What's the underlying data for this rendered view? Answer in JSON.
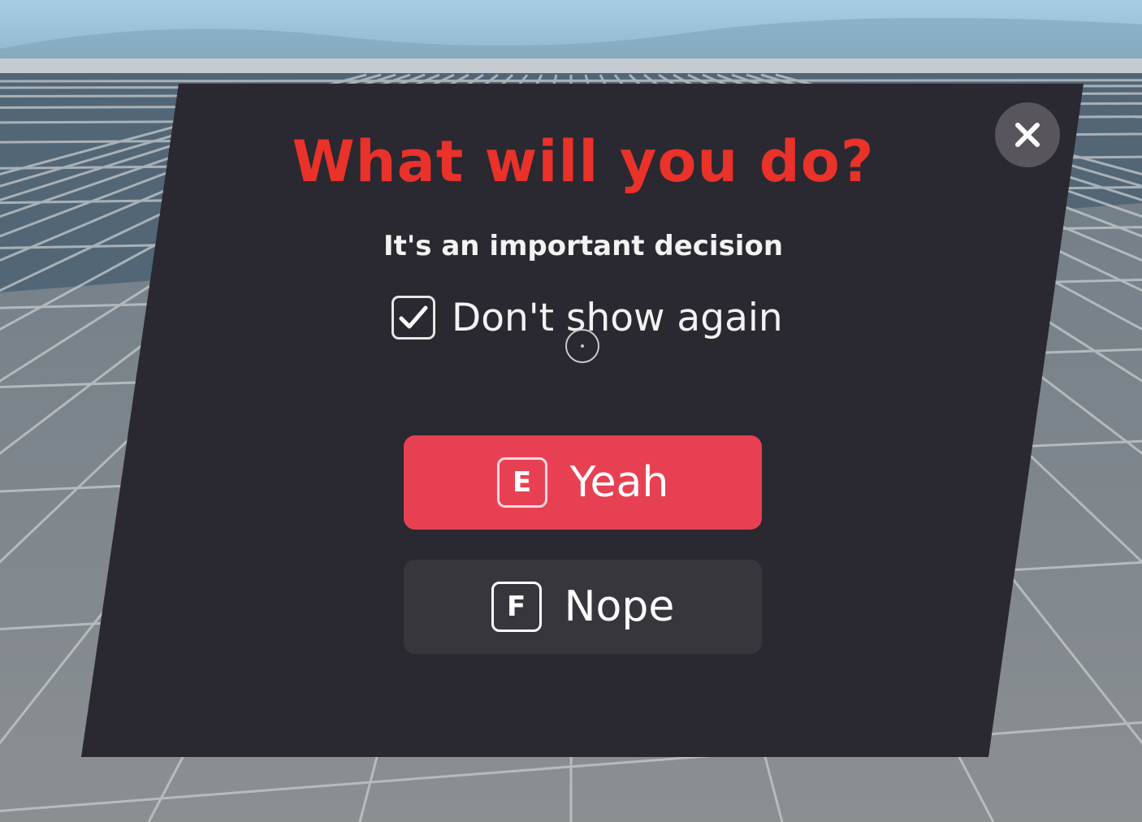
{
  "dialog": {
    "title": "What will you do?",
    "subtitle": "It's an important decision",
    "checkbox": {
      "label": "Don't show again",
      "checked": true,
      "icon": "checkmark-icon"
    },
    "buttons": [
      {
        "key": "E",
        "label": "Yeah",
        "color": "#e84053"
      },
      {
        "key": "F",
        "label": "Nope",
        "color": "#38363d"
      }
    ],
    "close_icon": "close-icon"
  },
  "colors": {
    "title": "#e8322a",
    "panel": "#2a2830",
    "primary_button": "#e84053",
    "secondary_button": "#38363d",
    "close_button": "#58565c"
  }
}
